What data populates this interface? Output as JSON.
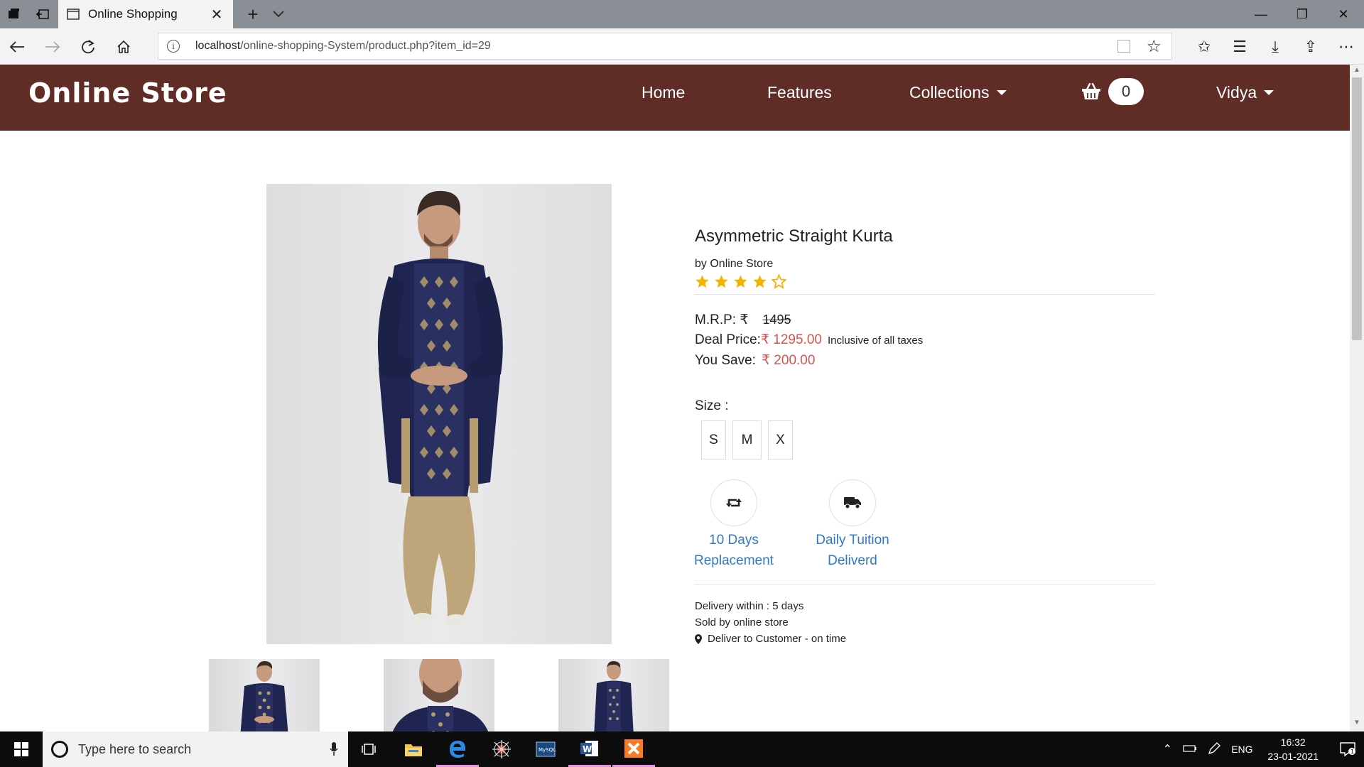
{
  "browser": {
    "tab_title": "Online Shopping",
    "url_host": "localhost",
    "url_path": "/online-shopping-System/product.php?item_id=29"
  },
  "navbar": {
    "brand": "Online Store",
    "links": [
      "Home",
      "Features",
      "Collections",
      "Vidya"
    ],
    "cart_count": "0",
    "bg_color": "#5f2c26"
  },
  "product": {
    "title": "Asymmetric Straight Kurta",
    "seller": "by Online Store",
    "rating": 4,
    "rating_max": 5,
    "mrp_label": "M.R.P: ₹",
    "mrp_value": "1495",
    "deal_label": "Deal Price:",
    "deal_value": "₹ 1295.00",
    "tax_note": "Inclusive of all taxes",
    "save_label": "You Save:",
    "save_value": "₹ 200.00",
    "size_label": "Size :",
    "sizes": [
      "S",
      "M",
      "X"
    ],
    "features": [
      {
        "line1": "10 Days",
        "line2": "Replacement",
        "icon": "retweet-icon"
      },
      {
        "line1": "Daily Tuition",
        "line2": "Deliverd",
        "icon": "truck-icon"
      }
    ],
    "delivery": "Delivery within : 5 days",
    "sold_by": "Sold by online store",
    "deliver_note": "Deliver to Customer - on time"
  },
  "taskbar": {
    "search_placeholder": "Type here to search",
    "language": "ENG",
    "time": "16:32",
    "date": "23-01-2021",
    "notifications": "1"
  }
}
